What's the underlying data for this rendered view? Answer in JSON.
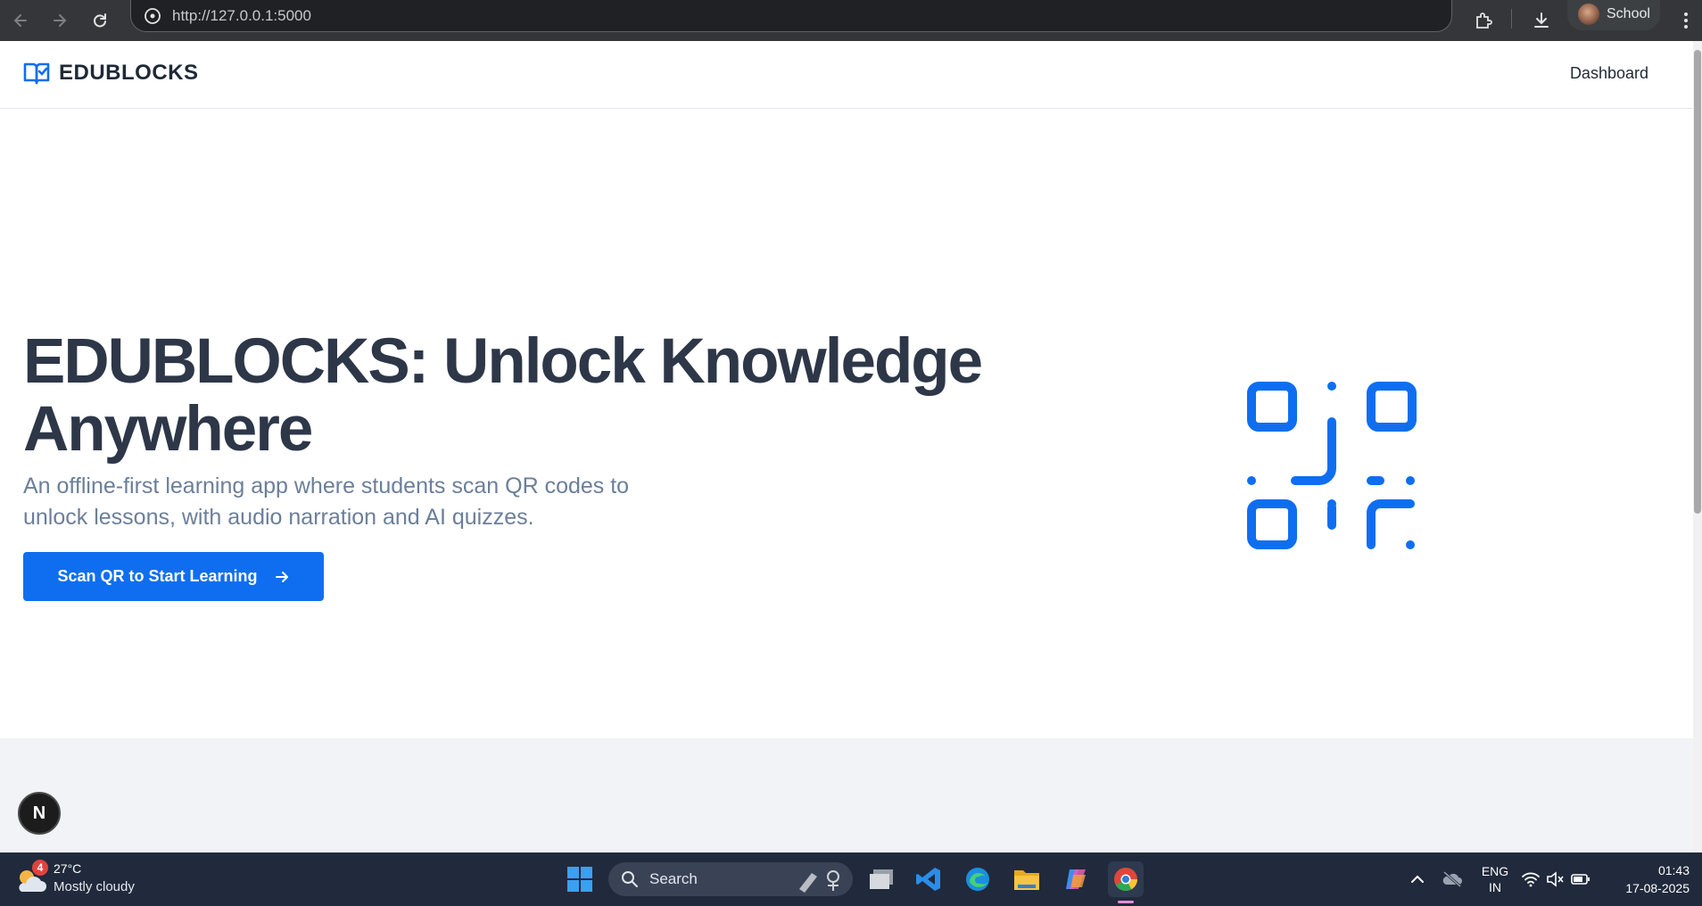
{
  "browser": {
    "url": "http://127.0.0.1:5000",
    "profile_name": "School"
  },
  "site": {
    "brand": "EDUBLOCKS",
    "nav": {
      "dashboard": "Dashboard"
    }
  },
  "hero": {
    "title_line1": "EDUBLOCKS: Unlock Knowledge",
    "title_line2": "Anywhere",
    "subtitle_line1": "An offline-first learning app where students scan QR codes to",
    "subtitle_line2": "unlock lessons, with audio narration and AI quizzes.",
    "cta_label": "Scan QR to Start Learning"
  },
  "dev_badge": "N",
  "taskbar": {
    "weather": {
      "temp": "27°C",
      "condition": "Mostly cloudy",
      "badge": "4"
    },
    "search_label": "Search",
    "language": {
      "line1": "ENG",
      "line2": "IN"
    },
    "clock": {
      "time": "01:43",
      "date": "17-08-2025"
    }
  },
  "colors": {
    "accent": "#0f6ef0",
    "heading": "#2d3748",
    "subtitle": "#6b7f9a",
    "taskbar": "#202a3c"
  }
}
